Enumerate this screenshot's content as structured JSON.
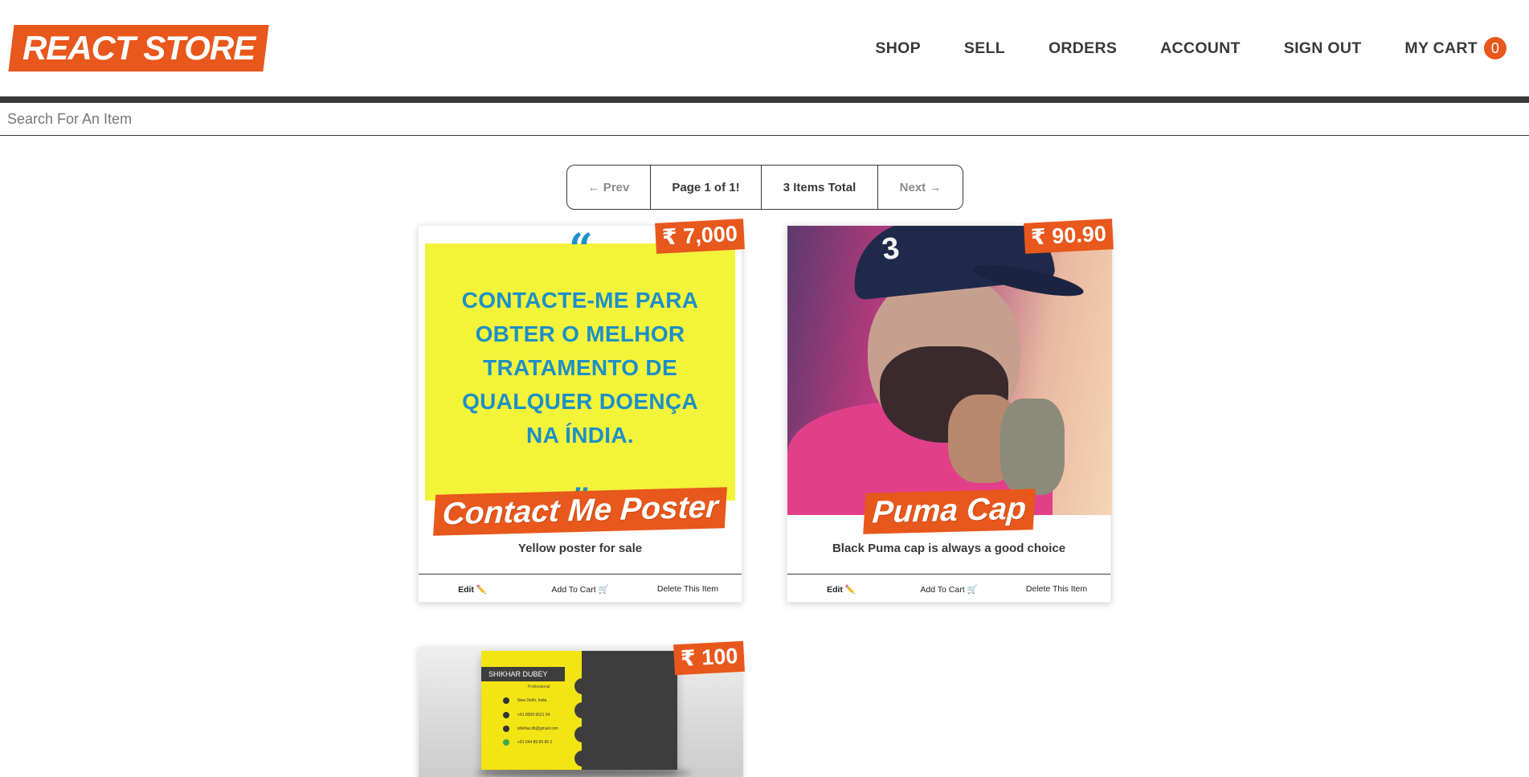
{
  "brand": {
    "logo": "REACT STORE",
    "accent": "#e8571b",
    "dark": "#393939"
  },
  "nav": {
    "shop": "SHOP",
    "sell": "SELL",
    "orders": "ORDERS",
    "account": "ACCOUNT",
    "sign_out": "SIGN OUT",
    "cart_label": "MY CART",
    "cart_count": "0"
  },
  "search": {
    "placeholder": "Search For An Item",
    "value": ""
  },
  "pagination": {
    "prev": "← Prev",
    "page": "Page 1 of 1!",
    "total": "3 Items Total",
    "next": "Next →"
  },
  "items": [
    {
      "price": "₹ 7,000",
      "title": "Contact Me Poster",
      "description": "Yellow poster for sale",
      "image_text": [
        "CONTACTE-ME PARA",
        "OBTER O MELHOR",
        "TRATAMENTO DE",
        "QUALQUER DOENÇA",
        "NA ÍNDIA."
      ],
      "quote_open": "“",
      "quote_close": "”",
      "edit": "Edit ✏️",
      "add_to_cart": "Add To Cart 🛒",
      "delete": "Delete This Item"
    },
    {
      "price": "₹ 90.90",
      "title": "Puma Cap",
      "description": "Black Puma cap is always a good choice",
      "cap_number": "3",
      "edit": "Edit ✏️",
      "add_to_cart": "Add To Cart 🛒",
      "delete": "Delete This Item"
    },
    {
      "price": "₹ 100",
      "card_name": "SHIKHAR DUBEY",
      "card_subtitle": "Professional",
      "card_lines": [
        "New Delhi, India",
        "+91 8009 9521 94",
        "shikhar.db@gmail.com",
        "+91 644 89 89 89 2"
      ]
    }
  ]
}
